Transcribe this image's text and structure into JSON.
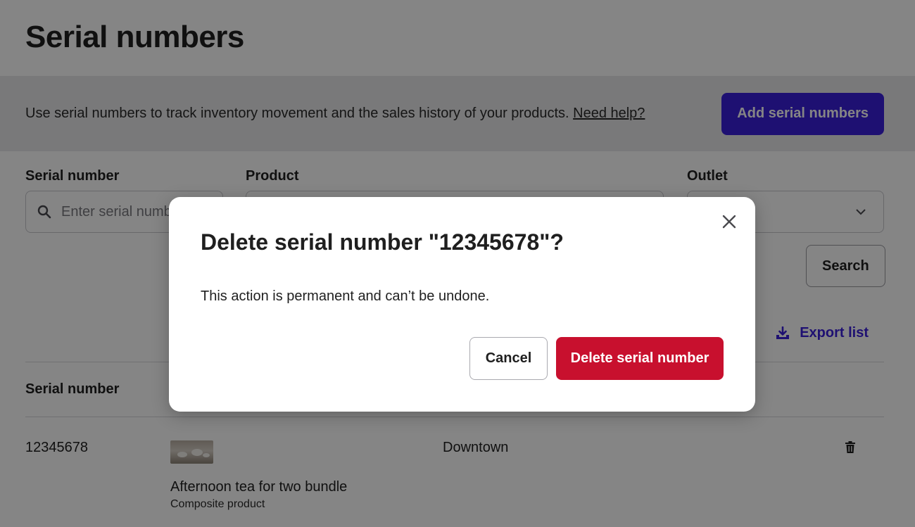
{
  "header": {
    "title": "Serial numbers"
  },
  "info": {
    "text": "Use serial numbers to track inventory movement and the sales history of your products. ",
    "help_link": "Need help?",
    "add_button": "Add serial numbers"
  },
  "filters": {
    "serial_label": "Serial number",
    "serial_placeholder": "Enter serial number",
    "product_label": "Product",
    "outlet_label": "Outlet",
    "search_button": "Search"
  },
  "results": {
    "export_label": "Export list",
    "columns": [
      "Serial number"
    ],
    "row": {
      "serial": "12345678",
      "product_name": "Afternoon tea for two bundle",
      "product_type": "Composite product",
      "outlet": "Downtown"
    }
  },
  "modal": {
    "title": "Delete serial number \"12345678\"?",
    "body": "This action is permanent and can’t be undone.",
    "cancel": "Cancel",
    "confirm": "Delete serial number"
  },
  "icons": {
    "search": "search-icon",
    "chevron": "chevron-down-icon",
    "download": "download-icon",
    "trash": "trash-icon",
    "close": "close-icon"
  },
  "colors": {
    "primary": "#3b1fdb",
    "danger": "#c8102e",
    "overlay": "rgba(0,0,0,0.48)"
  }
}
